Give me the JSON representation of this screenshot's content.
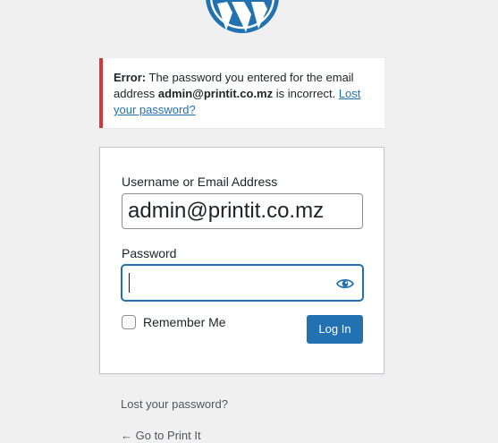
{
  "notice": {
    "error_prefix": "Error:",
    "line1_text": " The password you entered for the email",
    "line2_prefix": "address ",
    "email": "admin@printit.co.mz",
    "line2_suffix": " is incorrect. ",
    "lost_link_part1": "Lost",
    "lost_link_part2": "your password?"
  },
  "form": {
    "username_label": "Username or Email Address",
    "username_value": "admin@printit.co.mz",
    "password_label": "Password",
    "password_value": "",
    "remember_label": "Remember Me",
    "remember_checked": false,
    "login_button": "Log In"
  },
  "footer": {
    "lost_password": "Lost your password?",
    "back_to_site": "← Go to Print It"
  },
  "colors": {
    "accent": "#2271b1",
    "error": "#d63638",
    "background": "#f0f0f1"
  },
  "icons": {
    "logo": "wordpress-logo",
    "password_toggle": "eye-icon"
  }
}
